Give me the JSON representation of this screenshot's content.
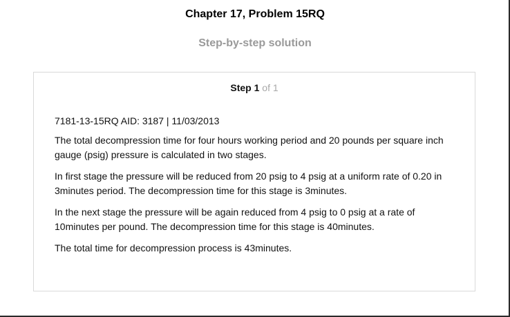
{
  "header": {
    "title": "Chapter 17, Problem 15RQ",
    "subtitle": "Step-by-step solution"
  },
  "step": {
    "label": "Step",
    "number": "1",
    "of_total": "of 1"
  },
  "content": {
    "meta": "7181-13-15RQ AID: 3187 | 11/03/2013",
    "paragraphs": [
      "The total decompression time for four hours working period and 20 pounds per square inch gauge (psig) pressure is calculated in two stages.",
      "In first stage the pressure will be reduced from 20 psig to 4 psig at a uniform rate of 0.20 in 3minutes period. The decompression time for this stage is 3minutes.",
      "In the next stage the pressure will be again reduced from 4 psig to 0 psig at a rate of 10minutes per pound. The decompression time for this stage is 40minutes.",
      "The total time for decompression process is 43minutes."
    ]
  }
}
